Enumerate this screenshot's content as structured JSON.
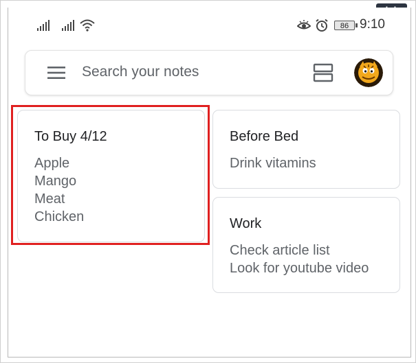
{
  "watermark": "alphr",
  "status_bar": {
    "battery_level": "86",
    "time": "9:10"
  },
  "search": {
    "placeholder": "Search your notes"
  },
  "notes": [
    {
      "title": "To Buy 4/12",
      "lines": [
        "Apple",
        "Mango",
        "Meat",
        "Chicken"
      ],
      "highlighted": true
    },
    {
      "title": "Before Bed",
      "lines": [
        "Drink vitamins"
      ]
    },
    {
      "title": "Work",
      "lines": [
        "Check article list",
        "Look for youtube video"
      ]
    }
  ],
  "colors": {
    "highlight": "#e02020",
    "text_primary": "#202124",
    "text_secondary": "#5f6368"
  }
}
